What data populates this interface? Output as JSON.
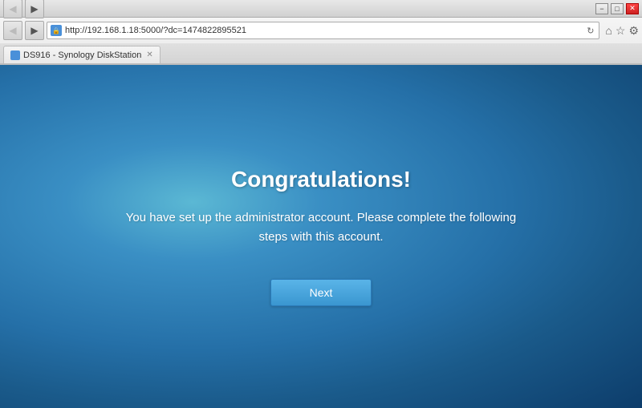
{
  "titlebar": {
    "minimize_label": "−",
    "maximize_label": "□",
    "close_label": "✕"
  },
  "browser": {
    "address": "http://192.168.1.18:5000/?dc=1474822895521",
    "address_icon": "🔒",
    "tab_title": "DS916 - Synology DiskStation",
    "refresh_label": "↻",
    "back_label": "◀",
    "forward_label": "▶",
    "home_label": "⌂",
    "star_label": "☆",
    "settings_label": "⚙"
  },
  "main": {
    "title": "Congratulations!",
    "description_line1": "You have set up the administrator account. Please complete the following",
    "description_line2": "steps with this account.",
    "next_button_label": "Next"
  }
}
